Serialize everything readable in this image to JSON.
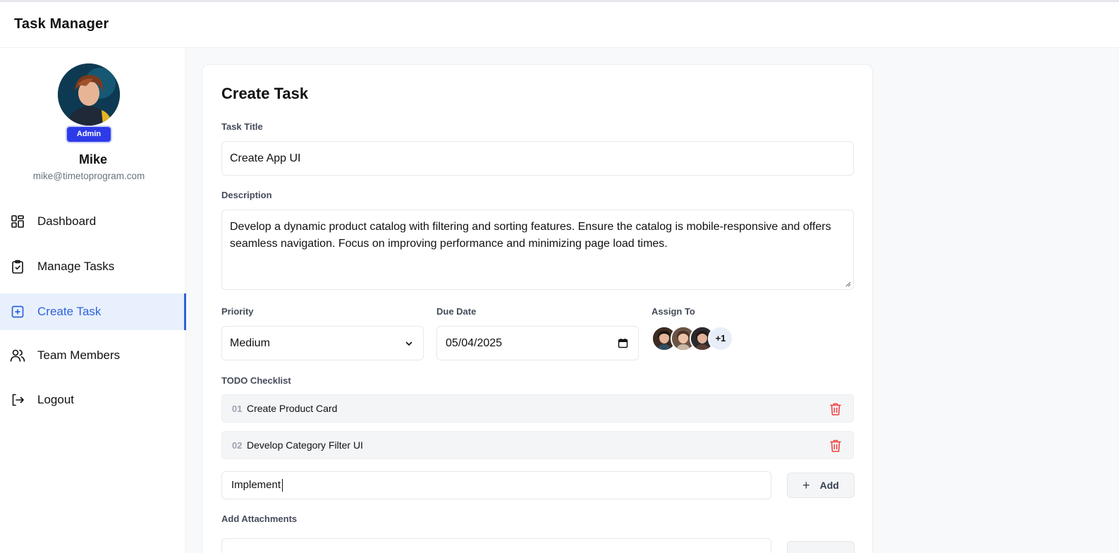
{
  "app": {
    "title": "Task Manager"
  },
  "user": {
    "role": "Admin",
    "name": "Mike",
    "email": "mike@timetoprogram.com"
  },
  "nav": {
    "items": [
      {
        "label": "Dashboard",
        "icon": "dashboard-icon",
        "active": false
      },
      {
        "label": "Manage Tasks",
        "icon": "clipboard-check-icon",
        "active": false
      },
      {
        "label": "Create Task",
        "icon": "plus-square-icon",
        "active": true
      },
      {
        "label": "Team Members",
        "icon": "users-icon",
        "active": false
      },
      {
        "label": "Logout",
        "icon": "logout-icon",
        "active": false
      }
    ]
  },
  "form": {
    "heading": "Create Task",
    "title_label": "Task Title",
    "title_value": "Create App UI",
    "description_label": "Description",
    "description_value": "Develop a dynamic product catalog with filtering and sorting features. Ensure the catalog is mobile-responsive and offers seamless navigation. Focus on improving performance and minimizing page load times.",
    "priority_label": "Priority",
    "priority_value": "Medium",
    "due_date_label": "Due Date",
    "due_date_value": "05/04/2025",
    "assign_label": "Assign To",
    "assign_more": "+1",
    "todo_label": "TODO Checklist",
    "todos": [
      {
        "num": "01",
        "text": "Create Product Card"
      },
      {
        "num": "02",
        "text": "Develop Category Filter UI"
      }
    ],
    "new_todo_value": "Implement",
    "add_label": "Add",
    "attachments_label": "Add Attachments"
  },
  "colors": {
    "accent": "#2f63d8",
    "badge": "#2d3ae8",
    "delete": "#ef4444"
  }
}
